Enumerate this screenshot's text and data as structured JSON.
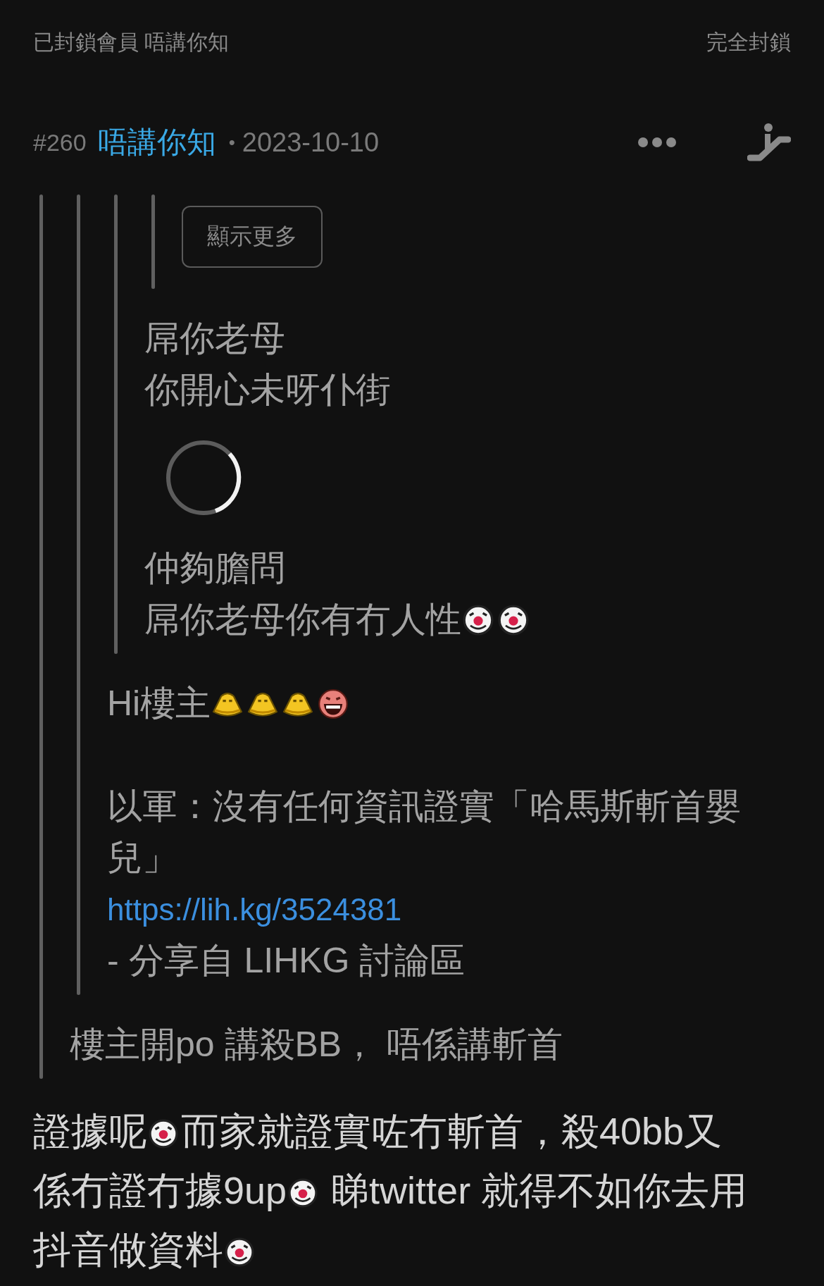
{
  "top_bar": {
    "blocked_notice": "已封鎖會員 唔講你知",
    "action": "完全封鎖"
  },
  "post": {
    "number": "#260",
    "author": "唔講你知",
    "separator": "•",
    "date": "2023-10-10",
    "quote": {
      "quote": {
        "quote": {
          "quote": {
            "blocks": [
              {
                "kind": "button",
                "label": "顯示更多"
              }
            ]
          },
          "blocks": [
            {
              "kind": "text",
              "parts": [
                {
                  "kind": "text",
                  "text": "屌你老母"
                }
              ]
            },
            {
              "kind": "text",
              "parts": [
                {
                  "kind": "text",
                  "text": "你開心未呀仆街"
                }
              ]
            },
            {
              "kind": "spinner"
            },
            {
              "kind": "text",
              "parts": [
                {
                  "kind": "text",
                  "text": "仲夠膽問"
                }
              ]
            },
            {
              "kind": "text",
              "parts": [
                {
                  "kind": "text",
                  "text": "屌你老母你有冇人性"
                },
                {
                  "kind": "clown"
                },
                {
                  "kind": "clown"
                }
              ]
            }
          ]
        },
        "blocks": [
          {
            "kind": "text",
            "parts": [
              {
                "kind": "text",
                "text": "Hi樓主"
              },
              {
                "kind": "squint"
              },
              {
                "kind": "squint"
              },
              {
                "kind": "squint"
              },
              {
                "kind": "laugh"
              }
            ]
          },
          {
            "kind": "break"
          },
          {
            "kind": "text",
            "parts": [
              {
                "kind": "text",
                "text": "以軍：沒有任何資訊證實「哈馬斯斬首嬰"
              }
            ]
          },
          {
            "kind": "text",
            "parts": [
              {
                "kind": "text",
                "text": "兒」"
              }
            ]
          },
          {
            "kind": "link",
            "text": "https://lih.kg/3524381"
          },
          {
            "kind": "text",
            "parts": [
              {
                "kind": "text",
                "text": "- 分享自 LIHKG 討論區"
              }
            ]
          }
        ]
      },
      "blocks": [
        {
          "kind": "text",
          "parts": [
            {
              "kind": "text",
              "text": "樓主開po 講殺BB， 唔係講斬首"
            }
          ]
        }
      ]
    },
    "body": [
      [
        {
          "kind": "text",
          "text": "證據呢"
        },
        {
          "kind": "clown"
        },
        {
          "kind": "text",
          "text": "而家就證實咗冇斬首，殺40bb又"
        }
      ],
      [
        {
          "kind": "text",
          "text": "係冇證冇據9up"
        },
        {
          "kind": "clown"
        },
        {
          "kind": "text",
          "text": " 睇twitter 就得不如你去用"
        }
      ],
      [
        {
          "kind": "text",
          "text": "抖音做資料"
        },
        {
          "kind": "clown"
        }
      ]
    ]
  }
}
